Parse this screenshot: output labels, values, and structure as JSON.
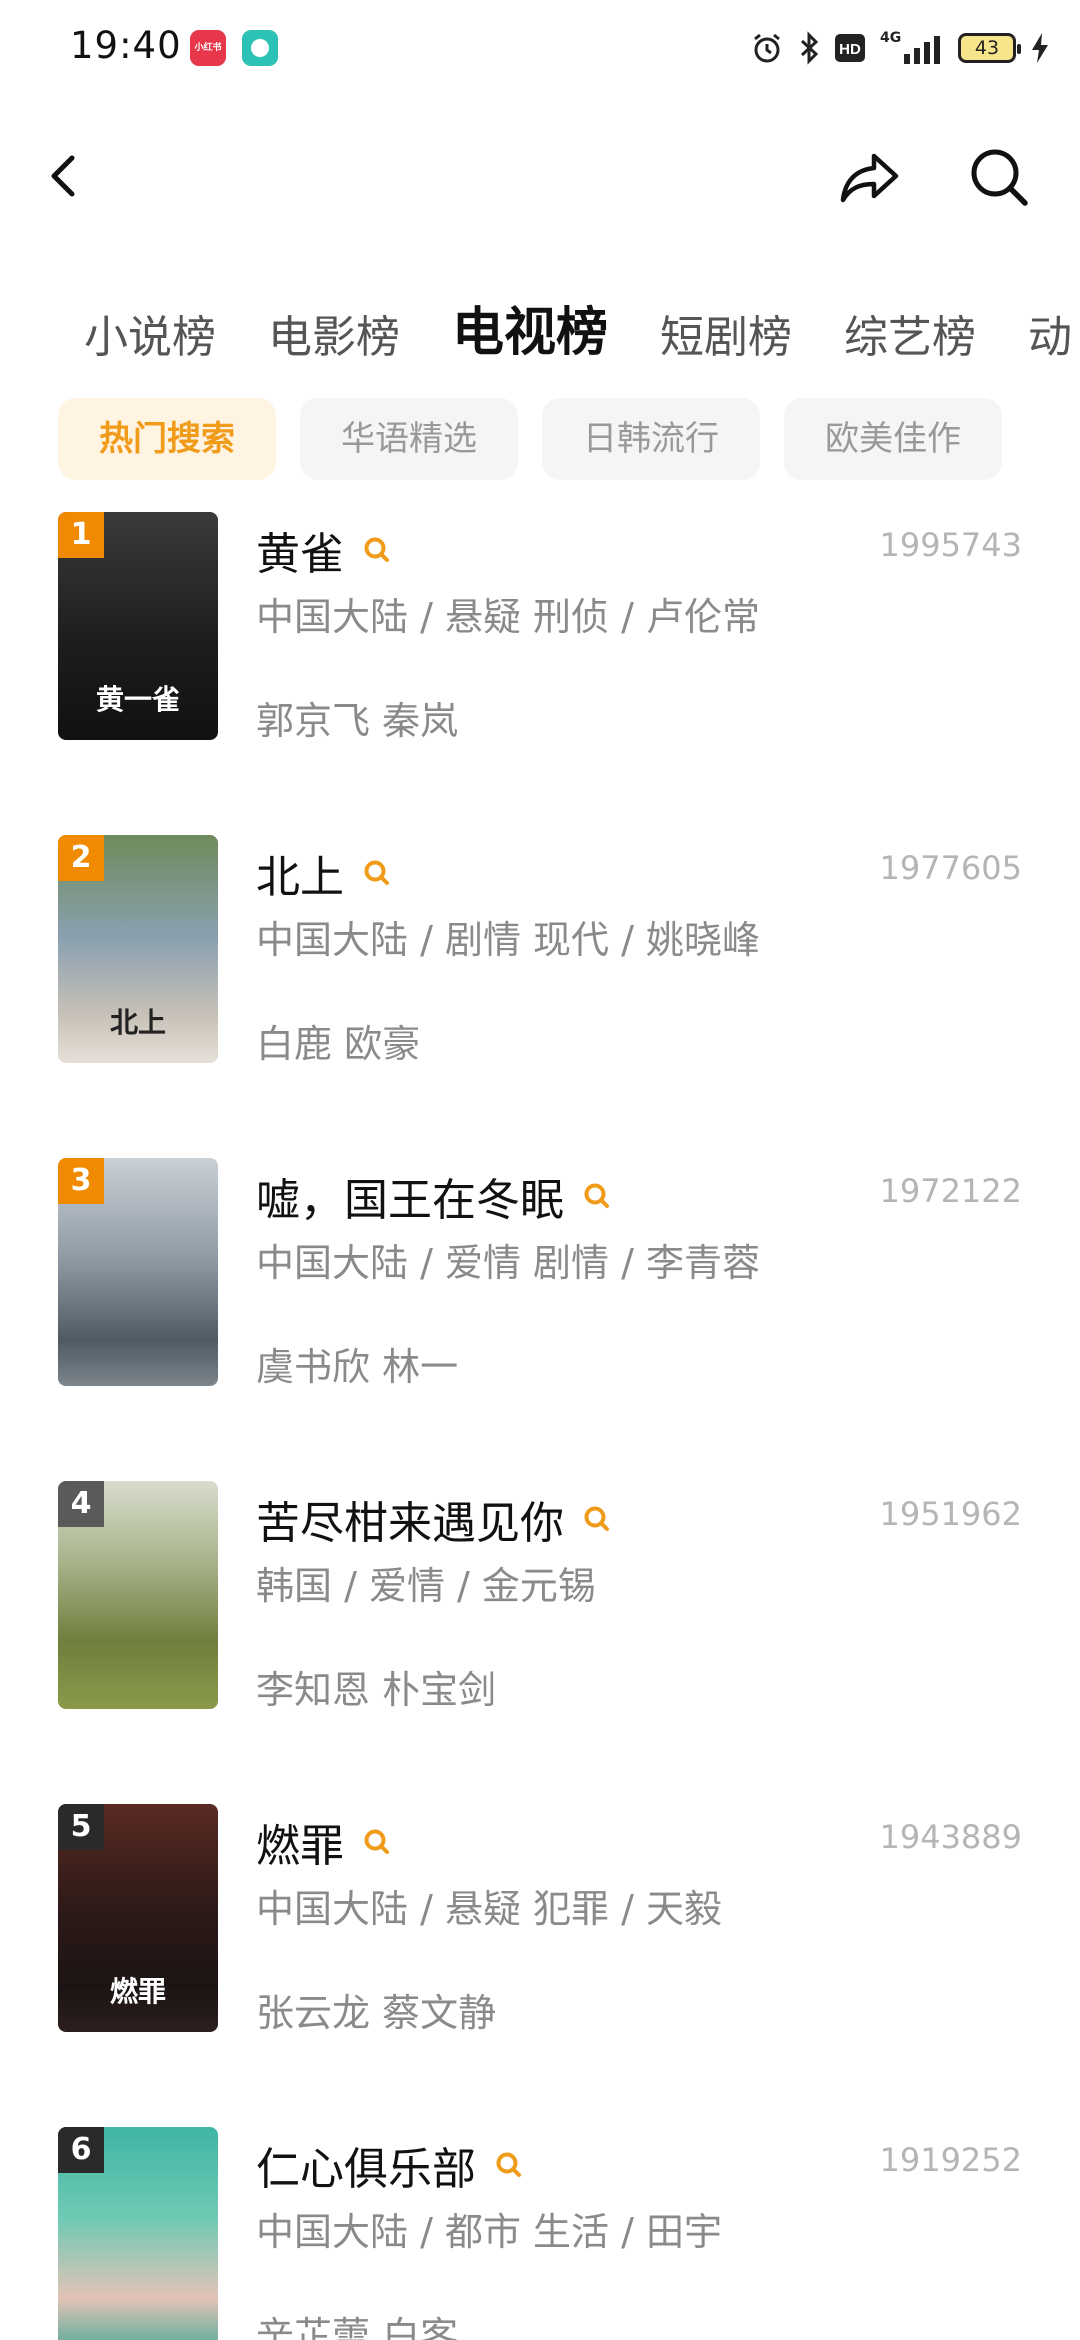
{
  "status_bar": {
    "time": "19:40",
    "app_badge_label": "小红书",
    "network": "4G",
    "battery_level": "43"
  },
  "colors": {
    "accent": "#f09b19",
    "rank_orange": "#f08a00",
    "rank_gray": "#5a5a5a"
  },
  "tabs": [
    {
      "label": "小说榜",
      "active": false
    },
    {
      "label": "电影榜",
      "active": false
    },
    {
      "label": "电视榜",
      "active": true
    },
    {
      "label": "短剧榜",
      "active": false
    },
    {
      "label": "综艺榜",
      "active": false
    },
    {
      "label": "动",
      "active": false
    }
  ],
  "chips": [
    {
      "label": "热门搜索",
      "active": true
    },
    {
      "label": "华语精选",
      "active": false
    },
    {
      "label": "日韩流行",
      "active": false
    },
    {
      "label": "欧美佳作",
      "active": false
    }
  ],
  "list": [
    {
      "rank": "1",
      "title": "黄雀",
      "score": "1995743",
      "meta": "中国大陆 / 悬疑 刑侦 / 卢伦常",
      "cast": "郭京飞 秦岚",
      "poster_text": "黄一雀",
      "poster_color": "#2a2a2a"
    },
    {
      "rank": "2",
      "title": "北上",
      "score": "1977605",
      "meta": "中国大陆 / 剧情 现代 / 姚晓峰",
      "cast": "白鹿 欧豪",
      "poster_text": "北上",
      "poster_color": "#7f8a6a"
    },
    {
      "rank": "3",
      "title": "嘘，国王在冬眠",
      "score": "1972122",
      "meta": "中国大陆 / 爱情 剧情 / 李青蓉",
      "cast": "虞书欣 林一",
      "poster_text": "",
      "poster_color": "#9aa4ad"
    },
    {
      "rank": "4",
      "title": "苦尽柑来遇见你",
      "score": "1951962",
      "meta": "韩国 / 爱情 / 金元锡",
      "cast": "李知恩 朴宝剑",
      "poster_text": "",
      "poster_color": "#8c9a5c"
    },
    {
      "rank": "5",
      "title": "燃罪",
      "score": "1943889",
      "meta": "中国大陆 / 悬疑 犯罪 / 天毅",
      "cast": "张云龙 蔡文静",
      "poster_text": "燃罪",
      "poster_color": "#2b1e1e"
    },
    {
      "rank": "6",
      "title": "仁心俱乐部",
      "score": "1919252",
      "meta": "中国大陆 / 都市 生活 / 田宇",
      "cast": "辛芷蕾 白客",
      "poster_text": "",
      "poster_color": "#3fb6a4"
    }
  ]
}
